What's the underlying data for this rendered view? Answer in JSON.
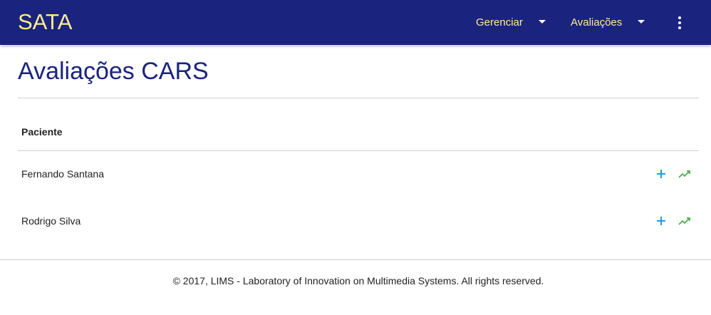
{
  "navbar": {
    "brand": "SATA",
    "menu": [
      {
        "label": "Gerenciar",
        "icon": "caret-down-icon"
      },
      {
        "label": "Avaliações",
        "icon": "caret-down-icon"
      }
    ],
    "more_icon": "more-vert-icon"
  },
  "page": {
    "title": "Avaliações CARS"
  },
  "table": {
    "header": "Paciente",
    "rows": [
      {
        "name": "Fernando Santana",
        "actions": [
          "add-icon",
          "trending-up-icon"
        ]
      },
      {
        "name": "Rodrigo Silva",
        "actions": [
          "add-icon",
          "trending-up-icon"
        ]
      }
    ]
  },
  "footer": {
    "text": "© 2017, LIMS - Laboratory of Innovation on Multimedia Systems. All rights reserved."
  },
  "colors": {
    "navbar_bg": "#1a237e",
    "brand_text": "#ffee8f",
    "title_text": "#1a237e",
    "add_icon": "#2196f3",
    "trend_icon": "#4caf50"
  }
}
